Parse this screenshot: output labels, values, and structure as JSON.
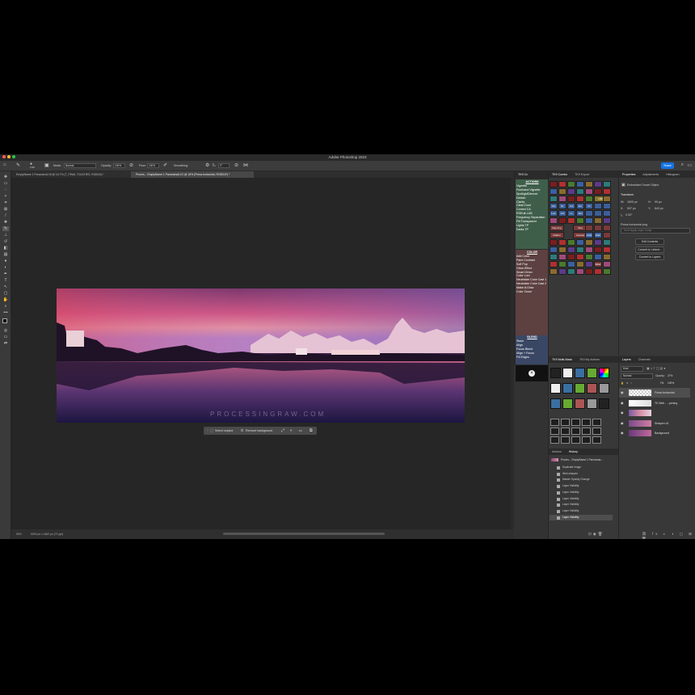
{
  "app": {
    "title": "Adobe Photoshop 2023",
    "share_label": "Share"
  },
  "options": {
    "brush_size": "2128",
    "mode_label": "Mode:",
    "mode_value": "Normal",
    "opacity_label": "Opacity:",
    "opacity_value": "100%",
    "flow_label": "Flow:",
    "flow_value": "100%",
    "smoothing_label": "Smoothing:",
    "angle_value": "0°"
  },
  "doc_tabs": [
    {
      "label": "EmptyName 1 Panorama2.tif @ 16.7% (T_FINAL TOUCHES, RGB/16) *"
    },
    {
      "label": "Proces... EmptyName 1 Panorama2-IG @ 16% (Firma-horizontal, RGB/16*) *"
    }
  ],
  "status": {
    "zoom": "50%",
    "doc_size": "5000 px x 1662 px (72 ppi)"
  },
  "context_bar": {
    "select_subject": "Select subject",
    "remove_background": "Remove background",
    "more": "•••"
  },
  "photo": {
    "watermark": "PROCESSINGRAW.COM"
  },
  "tk_cx": {
    "tab": "TK9 Cx",
    "actions_heading": "ACTIONS",
    "actions": [
      "Vignette",
      "Freehand Vignette",
      "SpotlightDimmer",
      "Detach",
      "Clarity",
      "Clean Dust",
      "Correct CA",
      "RGB ⇄ LAB",
      "Frequency Separation",
      "Fill Transparent",
      "Lights TP",
      "Darks TP"
    ],
    "color_heading": "COLOR",
    "color": [
      "Add Color",
      "Paint Contrast",
      "Soft Pop",
      "Orton Effect",
      "Smart Orton",
      "Color Lum",
      "Neutralize Color Cast 1",
      "Neutralize Color Cast 2",
      "Make-It-Glow",
      "Color Clone"
    ],
    "blend_heading": "BLEND",
    "blend": [
      "Stack",
      "Align",
      "Focus Blend",
      "Align + Focus",
      "Fill Edges"
    ]
  },
  "tk_combo": {
    "tabs": [
      "TK9 Combo",
      "TK9 Export"
    ],
    "row3": [
      "Nor",
      "SL",
      "Col",
      "Sor",
      "Vs"
    ],
    "row4": [
      "Lum",
      "Ovl",
      "LL",
      "Mul"
    ],
    "zoom_label": "100%",
    "buttons": [
      "Dup Img",
      "Size",
      "Flatten",
      "Canvas",
      "AGR",
      "D&F CAF",
      "B&W"
    ]
  },
  "properties": {
    "tabs": [
      "Properties",
      "Adjustments",
      "Histogram"
    ],
    "type_label": "Embedded Smart Object",
    "transform_label": "Transform",
    "w_label": "W:",
    "w_value": "1605 px",
    "h_label": "H:",
    "h_value": "99 px",
    "x_label": "X:",
    "x_value": "597 px",
    "y_label": "Y:",
    "y_value": "843 px",
    "angle_value": "0.00°",
    "file_name": "Firma-horizontal.png",
    "comp_placeholder": "Don't Apply Layer Comp",
    "buttons": [
      "Edit Contents",
      "Convert to Linked...",
      "Convert to Layers"
    ]
  },
  "multimask": {
    "tabs": [
      "TK9 Multi-Mask",
      "TK9 My Actions"
    ]
  },
  "layers": {
    "tabs": [
      "Layers",
      "Channels"
    ],
    "kind_label": "Kind",
    "blend_mode": "Normal",
    "opacity_label": "Opacity:",
    "opacity_value": "27%",
    "fill_label": "Fill:",
    "fill_value": "100%",
    "items": [
      {
        "name": "Firma-horizontal"
      },
      {
        "name": "TK Web - ...pening"
      },
      {
        "name": ""
      },
      {
        "name": "Sharpen #1"
      },
      {
        "name": "Background"
      }
    ]
  },
  "actions_history": {
    "tabs": [
      "Actions",
      "History"
    ],
    "snapshot": "Proces... EmptyName 1 Panorama...",
    "rows": [
      "Duplicate Image",
      "Web sharpen",
      "Master Opacity Change",
      "Layer Visibility",
      "Layer Visibility",
      "Layer Visibility",
      "Layer Visibility",
      "Layer Visibility",
      "Layer Visibility"
    ]
  }
}
